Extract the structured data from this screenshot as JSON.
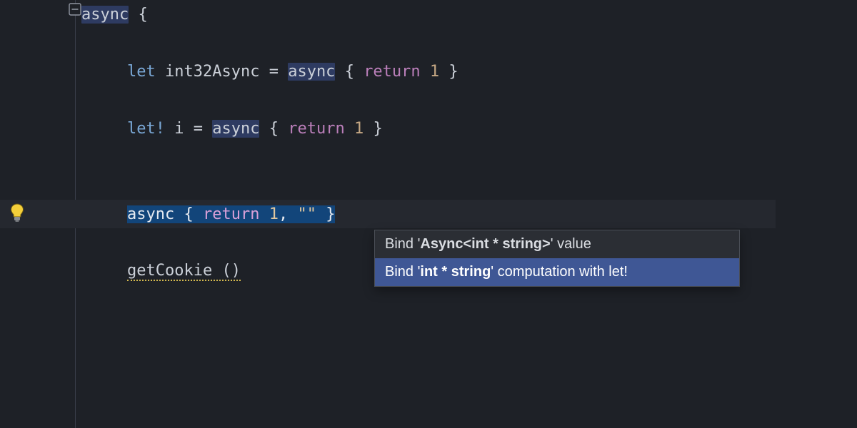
{
  "tokens": {
    "async": "async",
    "let": "let",
    "letBang": "let!",
    "ret": "return",
    "id_int32Async": "int32Async",
    "id_i": "i",
    "id_getCookie": "getCookie",
    "eq": "=",
    "lb": "{",
    "rb": "}",
    "one": "1",
    "comma": ",",
    "emptyStr": "\"\"",
    "unit": "()"
  },
  "menu": {
    "item1_pre": "Bind '",
    "item1_strong": "Async<int * string>",
    "item1_post": "' value",
    "item2_pre": "Bind '",
    "item2_strong": "int * string",
    "item2_post": "' computation with let!"
  }
}
